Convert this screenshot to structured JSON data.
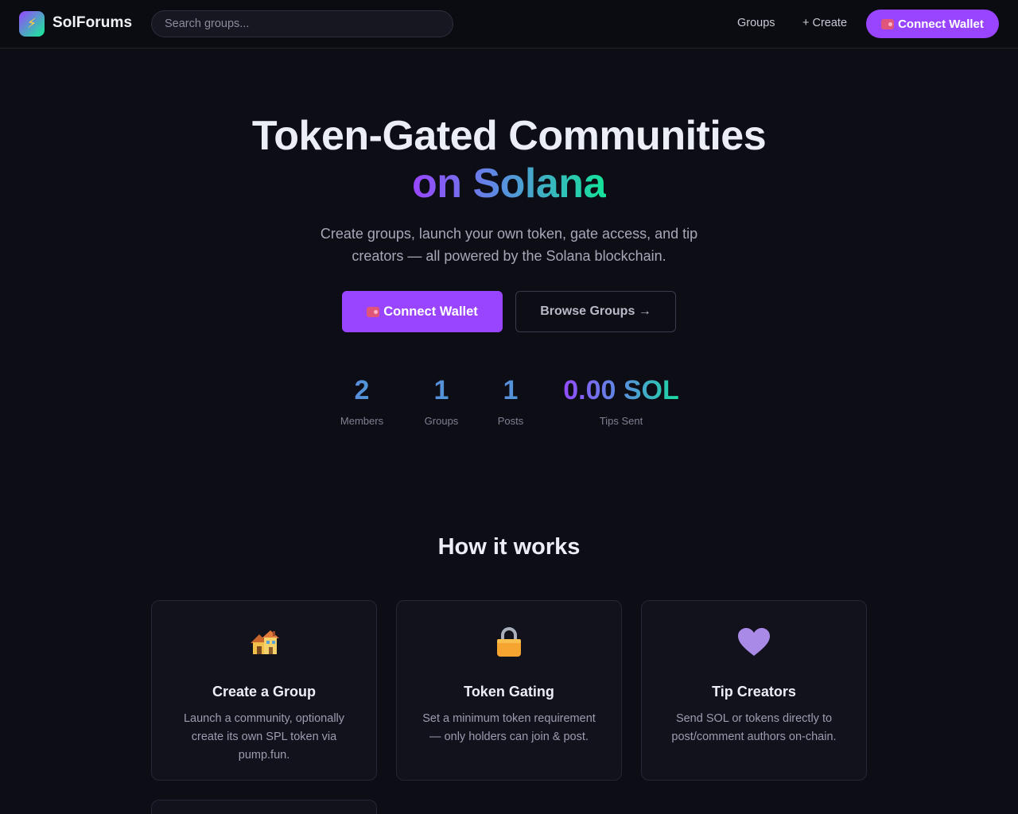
{
  "header": {
    "brand": "SolForums",
    "search_placeholder": "Search groups...",
    "nav_groups": "Groups",
    "nav_create": "+ Create",
    "connect_label": "Connect Wallet"
  },
  "hero": {
    "title_line1": "Token-Gated Communities",
    "title_line2": "on Solana",
    "subtitle": "Create groups, launch your own token, gate access, and tip creators — all powered by the Solana blockchain.",
    "connect_label": "Connect Wallet",
    "browse_label": "Browse Groups →"
  },
  "stats": [
    {
      "value": "2",
      "label": "Members"
    },
    {
      "value": "1",
      "label": "Groups"
    },
    {
      "value": "1",
      "label": "Posts"
    },
    {
      "value": "0.00 SOL",
      "label": "Tips Sent"
    }
  ],
  "how": {
    "title": "How it works",
    "cards": [
      {
        "icon": "house-icon",
        "title": "Create a Group",
        "desc": "Launch a community, optionally create its own SPL token via pump.fun."
      },
      {
        "icon": "lock-icon",
        "title": "Token Gating",
        "desc": "Set a minimum token requirement — only holders can join & post."
      },
      {
        "icon": "heart-icon",
        "title": "Tip Creators",
        "desc": "Send SOL or tokens directly to post/comment authors on-chain."
      }
    ]
  },
  "colors": {
    "accent": "#9945ff",
    "gradient_start": "#9945ff",
    "gradient_end": "#14f195",
    "background": "#0d0d15"
  }
}
